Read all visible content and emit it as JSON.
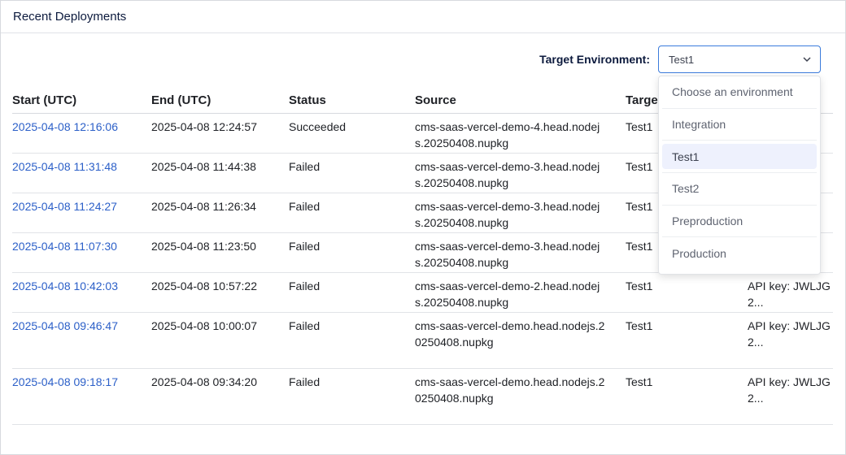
{
  "panel": {
    "title": "Recent Deployments"
  },
  "filter": {
    "label": "Target Environment:",
    "selected": "Test1",
    "options": [
      "Choose an environment",
      "Integration",
      "Test1",
      "Test2",
      "Preproduction",
      "Production"
    ]
  },
  "table": {
    "headers": [
      "Start (UTC)",
      "End (UTC)",
      "Status",
      "Source",
      "Targe",
      ""
    ],
    "rows": [
      {
        "start": "2025-04-08 12:16:06",
        "end": "2025-04-08 12:24:57",
        "status": "Succeeded",
        "source": "cms-saas-vercel-demo-4.head.nodejs.20250408.nupkg",
        "target": "Test1",
        "api": ""
      },
      {
        "start": "2025-04-08 11:31:48",
        "end": "2025-04-08 11:44:38",
        "status": "Failed",
        "source": "cms-saas-vercel-demo-3.head.nodejs.20250408.nupkg",
        "target": "Test1",
        "api": ""
      },
      {
        "start": "2025-04-08 11:24:27",
        "end": "2025-04-08 11:26:34",
        "status": "Failed",
        "source": "cms-saas-vercel-demo-3.head.nodejs.20250408.nupkg",
        "target": "Test1",
        "api": ""
      },
      {
        "start": "2025-04-08 11:07:30",
        "end": "2025-04-08 11:23:50",
        "status": "Failed",
        "source": "cms-saas-vercel-demo-3.head.nodejs.20250408.nupkg",
        "target": "Test1",
        "api": ""
      },
      {
        "start": "2025-04-08 10:42:03",
        "end": "2025-04-08 10:57:22",
        "status": "Failed",
        "source": "cms-saas-vercel-demo-2.head.nodejs.20250408.nupkg",
        "target": "Test1",
        "api": "API key: JWLJG2..."
      },
      {
        "start": "2025-04-08 09:46:47",
        "end": "2025-04-08 10:00:07",
        "status": "Failed",
        "source": "cms-saas-vercel-demo.head.nodejs.20250408.nupkg",
        "target": "Test1",
        "api": "API key: JWLJG2..."
      },
      {
        "start": "2025-04-08 09:18:17",
        "end": "2025-04-08 09:34:20",
        "status": "Failed",
        "source": "cms-saas-vercel-demo.head.nodejs.20250408.nupkg",
        "target": "Test1",
        "api": "API key: JWLJG2..."
      }
    ]
  }
}
